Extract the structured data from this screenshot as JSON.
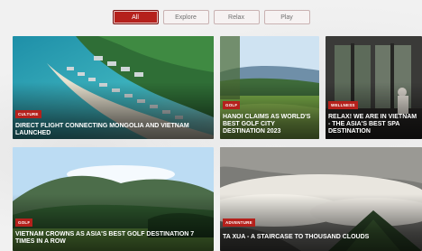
{
  "tabs": [
    {
      "label": "All",
      "active": true
    },
    {
      "label": "Explore",
      "active": false
    },
    {
      "label": "Relax",
      "active": false
    },
    {
      "label": "Play",
      "active": false
    }
  ],
  "cards": [
    {
      "category": "CULTURE",
      "title": "DIRECT FLIGHT CONNECTING MONGOLIA AND VIETNAM LAUNCHED"
    },
    {
      "category": "GOLF",
      "title": "HANOI CLAIMS AS WORLD'S BEST GOLF CITY DESTINATION 2023"
    },
    {
      "category": "WELLNESS",
      "title": "RELAX! WE ARE IN VIETNAM - THE ASIA'S BEST SPA DESTINATION"
    },
    {
      "category": "GOLF",
      "title": "VIETNAM CROWNS AS ASIA'S BEST GOLF DESTINATION 7 TIMES IN A ROW"
    },
    {
      "category": "ADVENTURE",
      "title": "TA XUA - A STAIRCASE TO THOUSAND CLOUDS"
    }
  ],
  "colors": {
    "accent": "#b5211c"
  }
}
